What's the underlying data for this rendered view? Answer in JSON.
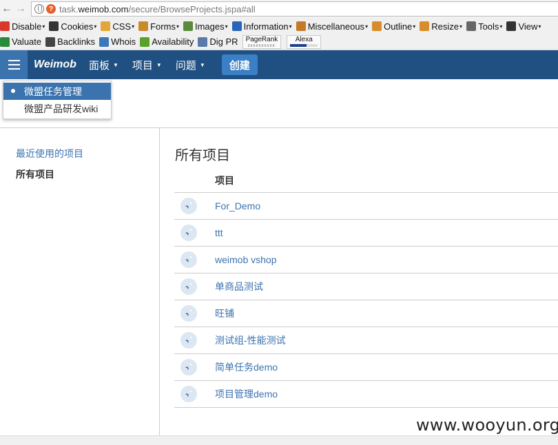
{
  "browser": {
    "url_prefix": "task.",
    "url_host": "weimob.com",
    "url_path": "/secure/BrowseProjects.jspa#all"
  },
  "toolbar_row1": [
    {
      "label": "Disable",
      "icon": "disable-icon",
      "color": "#d9372b"
    },
    {
      "label": "Cookies",
      "icon": "cookies-icon",
      "color": "#333333"
    },
    {
      "label": "CSS",
      "icon": "css-icon",
      "color": "#e2a63a"
    },
    {
      "label": "Forms",
      "icon": "forms-icon",
      "color": "#c98a2a"
    },
    {
      "label": "Images",
      "icon": "images-icon",
      "color": "#5a8a3c"
    },
    {
      "label": "Information",
      "icon": "information-icon",
      "color": "#2a63b8"
    },
    {
      "label": "Miscellaneous",
      "icon": "miscellaneous-icon",
      "color": "#c27a2a"
    },
    {
      "label": "Outline",
      "icon": "outline-icon",
      "color": "#d98c2a"
    },
    {
      "label": "Resize",
      "icon": "resize-icon",
      "color": "#d98c2a"
    },
    {
      "label": "Tools",
      "icon": "tools-icon",
      "color": "#666666"
    },
    {
      "label": "View",
      "icon": "view-icon",
      "color": "#333333"
    }
  ],
  "toolbar_row2": [
    {
      "label": "Valuate",
      "icon": "valuate-icon",
      "color": "#2a8a3c"
    },
    {
      "label": "Backlinks",
      "icon": "backlinks-icon",
      "color": "#444444"
    },
    {
      "label": "Whois",
      "icon": "whois-icon",
      "color": "#3a78b8"
    },
    {
      "label": "Availability",
      "icon": "availability-icon",
      "color": "#5aa02c"
    },
    {
      "label": "Dig PR",
      "icon": "dig-pr-icon",
      "color": "#5a7aa8"
    }
  ],
  "rank_widgets": {
    "pagerank": "PageRank",
    "alexa": "Alexa"
  },
  "header": {
    "logo": "Weimob",
    "nav": [
      "面板",
      "项目",
      "问题"
    ],
    "create_label": "创建",
    "bg_color": "#205081"
  },
  "dropdown": {
    "items": [
      {
        "label": "微盟任务管理",
        "active": true
      },
      {
        "label": "微盟产品研发wiki",
        "active": false
      }
    ]
  },
  "sidebar": {
    "recent": "最近使用的项目",
    "all": "所有项目"
  },
  "main": {
    "title": "所有项目",
    "column_header": "项目",
    "projects": [
      "For_Demo",
      "ttt",
      "weimob vshop",
      "单商品测试",
      "旺铺",
      "测试组-性能测试",
      "简单任务demo",
      "项目管理demo"
    ]
  },
  "watermark": "www.wooyun.org"
}
